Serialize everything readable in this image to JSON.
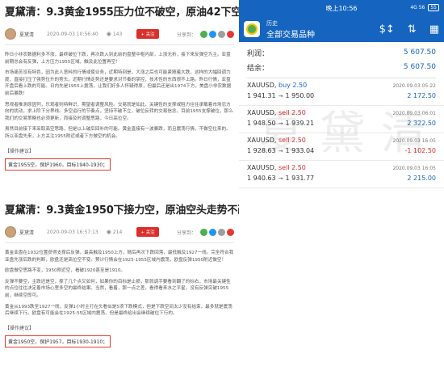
{
  "articles": [
    {
      "title": "夏黛清：9.3黄金1955压力位不破空，原油42下空！",
      "author": "夏黛清",
      "datetime": "2020-09-03 10:56:40",
      "views": "143",
      "follow_label": "+ 关注",
      "share_label": "分享到：",
      "paragraphs": [
        "昨日小非农数据利多不涨，最终破位下跌，再次跌入到此前的盘整中枢内部，上涨无折，接下来反弹空为主。亚盘前期总会有反弹，上方压力1955区域，触及此位置再空！",
        "市场痛苦没有特色，因为此人意料的行情或使业务，近期特别是，大涨之后也可能紧随着大跌，这样的大幅回调力度，直接打压了强势位升的势头。近期行情走势还是要求对节奏的掌控，技术性的东西很不上路。昨日行情，亚盘开盘后看上跌的可能。日内先是1955上震荡，让我们好多人怀疑得原，但最后还是出1974下方，美盘小非农数据前后暴跌！",
        "思视者推测原因列，乐观者则特鲜识，期望者调整风险。交易就是如此，关键性的支撑或阻力往往承载着市场忍方向的扰动，求上阶下分界线。多空运行的节奏点，坚持不破不立，破位反转的交易信念。目前1955支撑破位，那么我们的交易策略也必须更新，而接及时调整思路，今日高位空。",
        "虽然目前接下来采取高空思路，但是以上破后回补的可能。黄金直接有一波暴跌，而且震荡行情，不做空位来的。所以亚盘先来，上方关注1955附近或者下方做空的机会。"
      ],
      "suggest_title": "【操作建议】",
      "suggest_text": "黄金1955空，保护1960，目标1940-1930；"
    },
    {
      "title": "夏黛清：9.3黄金1950下接力空，原油空头走势不改！",
      "author": "夏黛清",
      "datetime": "2020-09-03 16:57:13",
      "views": "214",
      "follow_label": "+ 关注",
      "share_label": "分享到：",
      "paragraphs": [
        "黄金亚盘在1932位置获得支撑后反弹，最高触及1950上方，随后再次下跌回落，最低触及1927一线。完全符合我亚盘先涨后跌的判断，欧盘还是高位空不变。预计行情会在1925-1955区域内震荡，欧盘反弹1950附近做空！",
        "欧盘做空思路不变，1950附近空，看破1920甚至是1910。",
        "反弹不要空，主跌还是空，撑了几个点又如何，如果你的目标是止损，那就调手要看到翻了的标右，市场最关键性的点位往往决定着市场心里多空的最终结果。当然，看着，那一点之差，看得看来水之平星，没有反弹突破1955前，继续空即可。",
        "黄金从1993跌至1927一线，反弹1小时主打在头看似是5浪下跌模式，但是下跌空间太少没有结束，最多就是震荡后继续下行。欧盘有可能会在1925-55区域内震荡，但是最终给出会继续破位下行的。"
      ],
      "suggest_title": "【操作建议】",
      "suggest_text": "黄金1950空，保护1957，目标1930-1910；"
    }
  ],
  "phone": {
    "status_time": "晚上10:56",
    "status_right": "4G 56",
    "battery": "55",
    "appbar_sub": "历史",
    "appbar_title": "全部交易品种",
    "icons": {
      "symbol": "dollar-sort-icon",
      "sort": "sort-arrows-icon",
      "calendar": "calendar-icon"
    },
    "summary": [
      {
        "label": "利润：",
        "value": "5 607.50"
      },
      {
        "label": "结余：",
        "value": "5 607.50"
      }
    ],
    "trades": [
      {
        "symbol": "XAUUSD,",
        "action": "buy 2.50",
        "side": "buy",
        "date": "2020.09.03 05:22",
        "open": "1 941.31",
        "close": "1 950.00",
        "profit": "2 172.50",
        "profit_sign": "pos"
      },
      {
        "symbol": "XAUUSD,",
        "action": "sell 2.50",
        "side": "sell",
        "date": "2020.09.03 06:01",
        "open": "1 948.50",
        "close": "1 939.21",
        "profit": "2 322.50",
        "profit_sign": "pos"
      },
      {
        "symbol": "XAUUSD,",
        "action": "sell 2.50",
        "side": "sell",
        "date": "2020.09.03 16:05",
        "open": "1 928.63",
        "close": "1 933.04",
        "profit": "-1 102.50",
        "profit_sign": "neg"
      },
      {
        "symbol": "XAUUSD,",
        "action": "sell 2.50",
        "side": "sell",
        "date": "2020.09.03 16:05",
        "open": "1 940.63",
        "close": "1 931.77",
        "profit": "2 215.00",
        "profit_sign": "pos"
      }
    ]
  },
  "watermark": "夏黛清"
}
